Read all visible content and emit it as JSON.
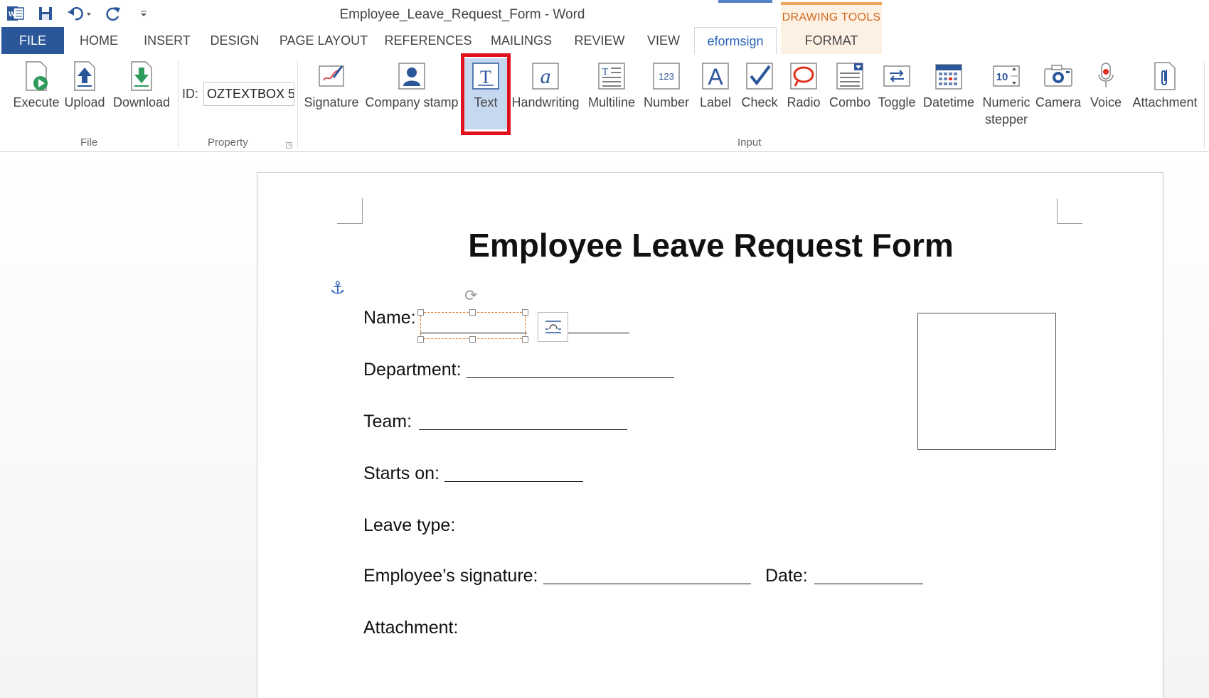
{
  "window": {
    "title": "Employee_Leave_Request_Form - Word"
  },
  "contextual": {
    "drawing_tools": "DRAWING TOOLS"
  },
  "tabs": {
    "file": "FILE",
    "home": "HOME",
    "insert": "INSERT",
    "design": "DESIGN",
    "page_layout": "PAGE LAYOUT",
    "references": "REFERENCES",
    "mailings": "MAILINGS",
    "review": "REVIEW",
    "view": "VIEW",
    "eformsign": "eformsign",
    "format": "FORMAT"
  },
  "ribbon": {
    "file_group": {
      "label": "File",
      "execute": "Execute",
      "upload": "Upload",
      "download": "Download"
    },
    "property_group": {
      "label": "Property",
      "id_label": "ID:",
      "id_value": "OZTEXTBOX 5"
    },
    "input_group": {
      "label": "Input",
      "signature": "Signature",
      "company_stamp": "Company stamp",
      "text": "Text",
      "handwriting": "Handwriting",
      "multiline": "Multiline",
      "number": "Number",
      "label_btn": "Label",
      "check": "Check",
      "radio": "Radio",
      "combo": "Combo",
      "toggle": "Toggle",
      "datetime": "Datetime",
      "numeric_stepper_1": "Numeric",
      "numeric_stepper_2": "stepper",
      "camera": "Camera",
      "voice": "Voice",
      "attachment": "Attachment"
    },
    "icon_glyphs": {
      "text": "T",
      "label": "A",
      "number": "123",
      "stepper": "10",
      "handwriting": "a"
    }
  },
  "document": {
    "heading": "Employee Leave Request Form",
    "fields": {
      "name": "Name:",
      "department": "Department:",
      "team": "Team:",
      "starts_on": "Starts on:",
      "leave_type": "Leave type:",
      "signature": "Employee’s signature:",
      "date": "Date:",
      "attachment": "Attachment:"
    }
  },
  "colors": {
    "file_tab": "#2b579a",
    "accent": "#2b64b8",
    "highlight": "#e0111c",
    "selected_bg": "#c5d8f0",
    "drawing_tools": "#d2691e"
  }
}
